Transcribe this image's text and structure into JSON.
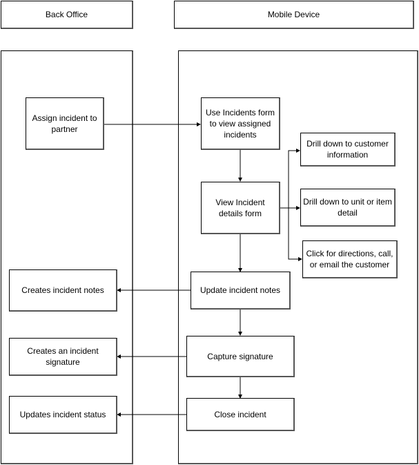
{
  "lanes": {
    "back_office": "Back Office",
    "mobile_device": "Mobile Device"
  },
  "nodes": {
    "assign": "Assign incident to partner",
    "use_form": "Use Incidents form to view assigned incidents",
    "drill_customer": "Drill down to customer information",
    "view_details": "View Incident details form",
    "drill_unit": "Drill down to unit or item detail",
    "click_directions": "Click for directions, call, or email the customer",
    "update_notes": "Update incident notes",
    "creates_notes": "Creates incident notes",
    "capture_signature": "Capture signature",
    "creates_signature": "Creates an incident signature",
    "close_incident": "Close incident",
    "updates_status": "Updates incident status"
  },
  "edges": [
    {
      "from": "assign",
      "to": "use_form"
    },
    {
      "from": "use_form",
      "to": "view_details"
    },
    {
      "from": "view_details",
      "to": "drill_customer"
    },
    {
      "from": "view_details",
      "to": "drill_unit"
    },
    {
      "from": "view_details",
      "to": "click_directions"
    },
    {
      "from": "view_details",
      "to": "update_notes"
    },
    {
      "from": "update_notes",
      "to": "creates_notes"
    },
    {
      "from": "update_notes",
      "to": "capture_signature"
    },
    {
      "from": "capture_signature",
      "to": "creates_signature"
    },
    {
      "from": "capture_signature",
      "to": "close_incident"
    },
    {
      "from": "close_incident",
      "to": "updates_status"
    }
  ]
}
